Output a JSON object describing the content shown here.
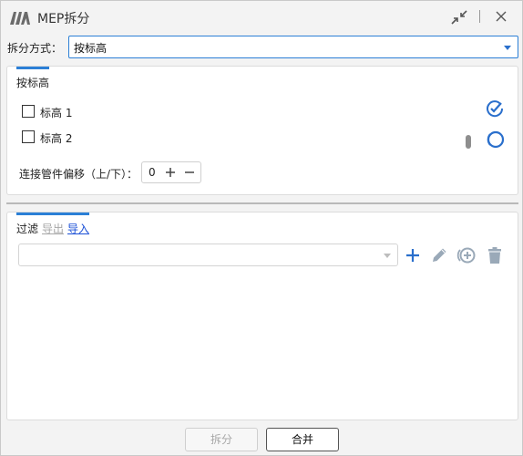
{
  "window": {
    "title": "MEP拆分"
  },
  "mode": {
    "label": "拆分方式：",
    "selected": "按标高"
  },
  "levels_panel": {
    "tab_label": "按标高",
    "levels": [
      {
        "label": "标高 1"
      },
      {
        "label": "标高 2"
      }
    ],
    "offset": {
      "label": "连接管件偏移（上/下）：",
      "value": "0"
    }
  },
  "filter_panel": {
    "tabs": {
      "filter": "过滤",
      "export": "导出",
      "import": "导入"
    },
    "filter_value": ""
  },
  "buttons": {
    "split": "拆分",
    "merge": "合并"
  },
  "colors": {
    "accent": "#2b7fd6",
    "icon_blue": "#2a6fcc",
    "icon_gray": "#9aa9b8",
    "disabled_text": "#a7a7a7"
  },
  "icons": {
    "logo": "app-logo-icon",
    "collapse": "collapse-arrows-icon",
    "close": "close-icon",
    "select_all": "check-circle-icon",
    "deselect": "ring-icon",
    "add": "plus-icon",
    "edit": "pencil-icon",
    "add_circle": "add-circle-icon",
    "delete": "trash-icon"
  }
}
